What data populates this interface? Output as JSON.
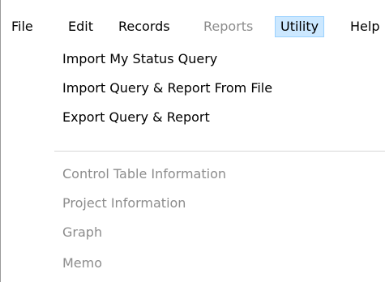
{
  "menubar": {
    "items": [
      {
        "label": "File",
        "enabled": true
      },
      {
        "label": "Edit",
        "enabled": true
      },
      {
        "label": "Records",
        "enabled": true
      },
      {
        "label": "Reports",
        "enabled": false
      },
      {
        "label": "Utility",
        "enabled": true,
        "active": true
      },
      {
        "label": "Help",
        "enabled": true
      }
    ]
  },
  "utility_menu": {
    "items": [
      {
        "label": "Import My Status Query",
        "enabled": true
      },
      {
        "label": "Import Query & Report From File",
        "enabled": true
      },
      {
        "label": "Export Query & Report",
        "enabled": true
      },
      {
        "label": "Control Table Information",
        "enabled": false
      },
      {
        "label": "Project Information",
        "enabled": false
      },
      {
        "label": "Graph",
        "enabled": false
      },
      {
        "label": "Memo",
        "enabled": false
      }
    ]
  },
  "colors": {
    "active_menu_bg": "#cce8ff",
    "active_menu_border": "#99d1ff",
    "disabled_text": "#8c8c8c",
    "separator": "#d7d7d7"
  }
}
